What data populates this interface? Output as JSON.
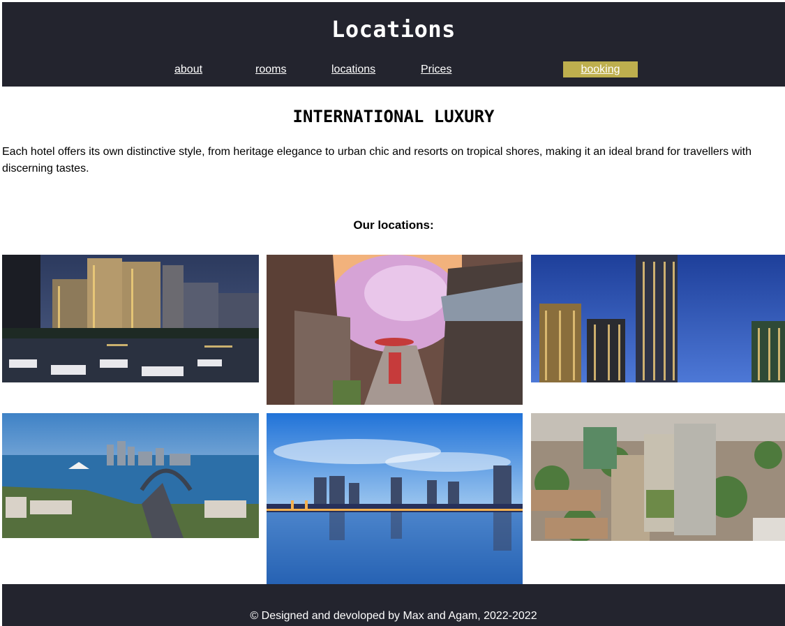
{
  "header": {
    "title": "Locations",
    "nav": [
      "about",
      "rooms",
      "locations",
      "Prices"
    ],
    "booking_label": "booking"
  },
  "main": {
    "heading": "INTERNATIONAL LUXURY",
    "intro": "Each hotel offers its own distinctive style, from heritage elegance to urban chic and resorts on tropical shores, making it an ideal brand for travellers with discerning tastes.",
    "subheading": "Our locations:"
  },
  "footer": {
    "copyright": "© Designed and devoloped by Max and Agam, 2022-2022"
  },
  "colors": {
    "header_bg": "#23242e",
    "booking_bg": "#beaf4e"
  }
}
